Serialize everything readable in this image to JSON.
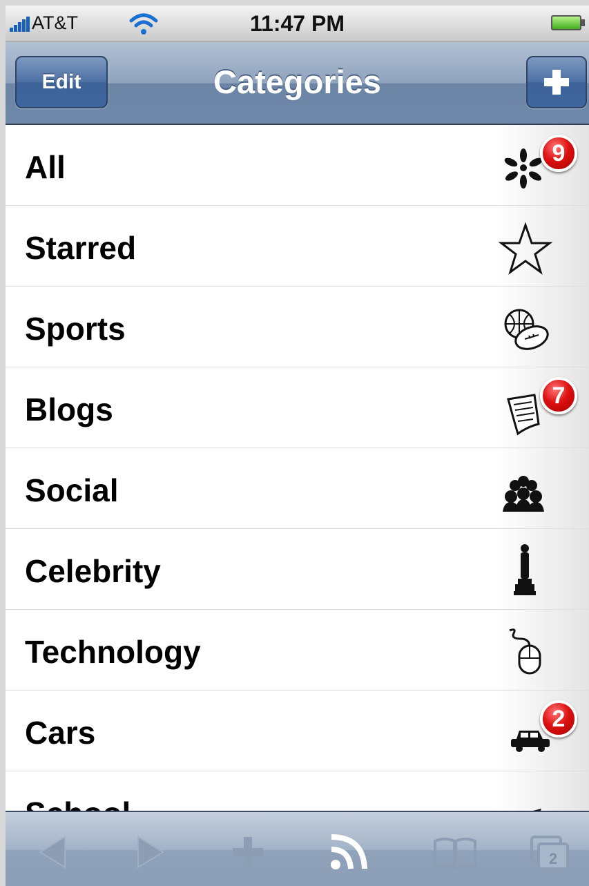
{
  "status_bar": {
    "carrier": "AT&T",
    "time": "11:47 PM",
    "signal_icon": "signal-bars-icon",
    "wifi_icon": "wifi-icon",
    "battery_icon": "battery-icon"
  },
  "nav_bar": {
    "edit_label": "Edit",
    "title": "Categories",
    "add_label": "+"
  },
  "categories": [
    {
      "label": "All",
      "icon": "asterisk-icon",
      "badge": "9"
    },
    {
      "label": "Starred",
      "icon": "star-icon",
      "badge": ""
    },
    {
      "label": "Sports",
      "icon": "balls-icon",
      "badge": ""
    },
    {
      "label": "Blogs",
      "icon": "note-icon",
      "badge": "7"
    },
    {
      "label": "Social",
      "icon": "people-icon",
      "badge": ""
    },
    {
      "label": "Celebrity",
      "icon": "trophy-icon",
      "badge": ""
    },
    {
      "label": "Technology",
      "icon": "mouse-icon",
      "badge": ""
    },
    {
      "label": "Cars",
      "icon": "car-icon",
      "badge": "2"
    },
    {
      "label": "School",
      "icon": "mortarboard-icon",
      "badge": ""
    }
  ],
  "toolbar": {
    "items": [
      "back-arrow-icon",
      "forward-arrow-icon",
      "add-icon",
      "rss-icon",
      "bookmarks-icon",
      "tabs-icon"
    ],
    "tabs_count": "2"
  },
  "colors": {
    "nav_tint": "#6c85a6",
    "badge_red": "#d11111",
    "toolbar_icon": "#7f8fa6"
  }
}
